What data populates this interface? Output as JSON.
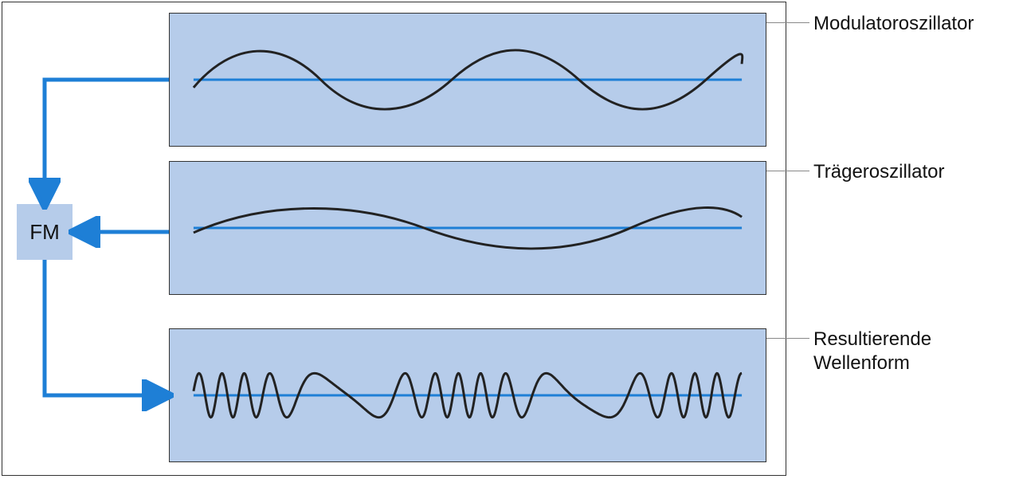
{
  "fm": {
    "label": "FM"
  },
  "boxes": {
    "modulator": {
      "label": "Modulatoroszillator"
    },
    "carrier": {
      "label": "Trägeroszillator"
    },
    "result": {
      "label": "Resultierende Wellenform"
    }
  },
  "colors": {
    "accent": "#1e7fd6",
    "panel": "#b6ccea",
    "border": "#333333",
    "callout": "#888888"
  },
  "chart_data": [
    {
      "type": "line",
      "title": "Modulatoroszillator",
      "xlabel": "",
      "ylabel": "",
      "ylim": [
        -1,
        1
      ],
      "series": [
        {
          "name": "axis",
          "values": [
            "horizontal zero line"
          ]
        },
        {
          "name": "wave",
          "values": [
            "sine, ~3 cycles across panel, moderate amplitude"
          ]
        }
      ]
    },
    {
      "type": "line",
      "title": "Trägeroszillator",
      "xlabel": "",
      "ylabel": "",
      "ylim": [
        -1,
        1
      ],
      "series": [
        {
          "name": "axis",
          "values": [
            "horizontal zero line"
          ]
        },
        {
          "name": "wave",
          "values": [
            "sine, ~2 cycles across panel, low amplitude"
          ]
        }
      ]
    },
    {
      "type": "line",
      "title": "Resultierende Wellenform",
      "xlabel": "",
      "ylabel": "",
      "ylim": [
        -1,
        1
      ],
      "series": [
        {
          "name": "axis",
          "values": [
            "horizontal zero line"
          ]
        },
        {
          "name": "wave",
          "values": [
            "FM output: variable-frequency sine with frequency speeding up and slowing down several times"
          ]
        }
      ]
    }
  ]
}
